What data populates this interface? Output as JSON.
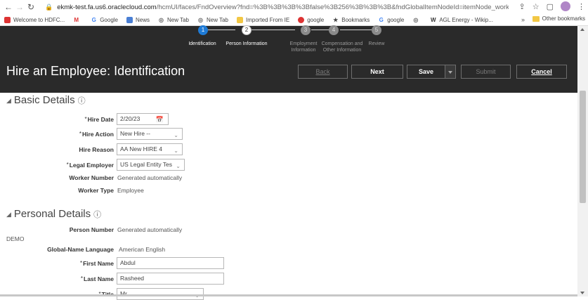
{
  "browser": {
    "url_host": "ekmk-test.fa.us6.oraclecloud.com",
    "url_path": "/hcmUI/faces/FndOverview?fnd=%3B%3B%3B%3Bfalse%3B256%3B%3B%3B&fndGlobalItemNodeId=itemNode_workforce_manageme...",
    "bookmarks": [
      "Welcome to HDFC...",
      "Gmail",
      "Google",
      "News",
      "New Tab",
      "New Tab",
      "Imported From IE",
      "google",
      "Bookmarks",
      "google",
      "New Tab",
      "AGL Energy - Wikip..."
    ],
    "bookmarks_more": "»",
    "other_bookmarks": "Other bookmarks"
  },
  "train": {
    "steps": [
      {
        "number": "1",
        "label": "Identification",
        "state": "active"
      },
      {
        "number": "2",
        "label": "Person Information",
        "state": "visited"
      },
      {
        "number": "3",
        "label": "Employment Information",
        "state": "future"
      },
      {
        "number": "4",
        "label": "Compensation and Other Information",
        "state": "future"
      },
      {
        "number": "5",
        "label": "Review",
        "state": "future"
      }
    ]
  },
  "header": {
    "title": "Hire an Employee: Identification",
    "back_label": "Back",
    "next_label": "Next",
    "save_label": "Save",
    "submit_label": "Submit",
    "cancel_label": "Cancel"
  },
  "basic_details": {
    "title": "Basic Details",
    "hire_date_label": "Hire Date",
    "hire_date_value": "2/20/23",
    "hire_action_label": "Hire Action",
    "hire_action_value": "New Hire --",
    "hire_reason_label": "Hire Reason",
    "hire_reason_value": "AA New HIRE 4",
    "legal_employer_label": "Legal Employer",
    "legal_employer_value": "US Legal Entity Tes",
    "worker_number_label": "Worker Number",
    "worker_number_value": "Generated automatically",
    "worker_type_label": "Worker Type",
    "worker_type_value": "Employee"
  },
  "personal_details": {
    "title": "Personal Details",
    "person_number_label": "Person Number",
    "person_number_value": "Generated automatically",
    "demo_text": "DEMO",
    "global_name_language_label": "Global-Name Language",
    "global_name_language_value": "American English",
    "first_name_label": "First Name",
    "first_name_value": "Abdul",
    "last_name_label": "Last Name",
    "last_name_value": "Rasheed",
    "title_label": "Title",
    "title_value": "Mr."
  },
  "colors": {
    "header_bg": "#2a2a2a",
    "active_step": "#1f7bd6"
  }
}
